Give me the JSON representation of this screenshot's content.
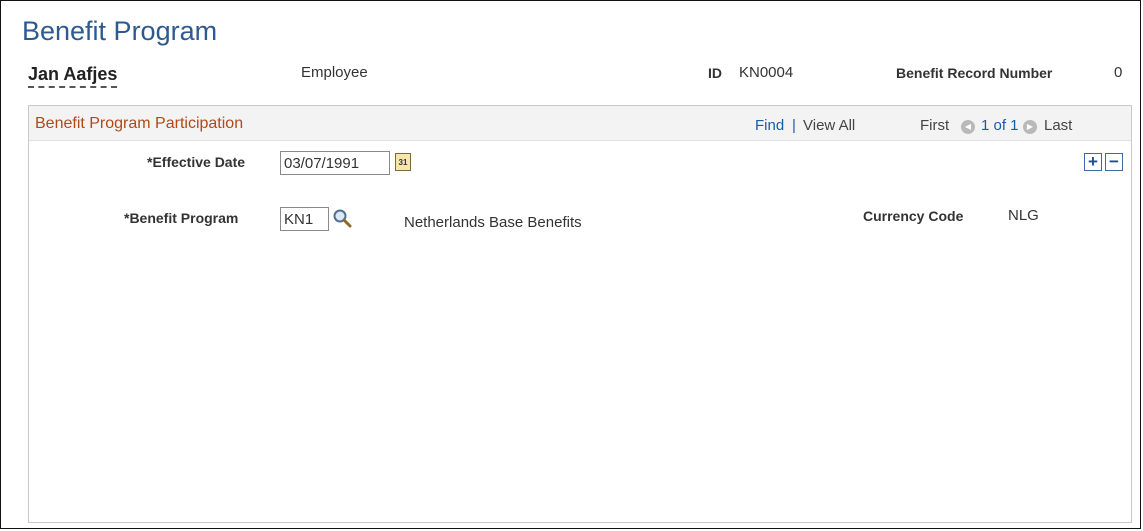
{
  "page": {
    "title": "Benefit Program"
  },
  "employee": {
    "name": "Jan Aafjes",
    "relation": "Employee",
    "id_label": "ID",
    "id_value": "KN0004",
    "benefit_record_label": "Benefit Record Number",
    "benefit_record_value": "0"
  },
  "grid": {
    "title": "Benefit Program Participation",
    "find_label": "Find",
    "separator": "|",
    "view_all_label": "View All",
    "first_label": "First",
    "page_info": "1 of 1",
    "last_label": "Last",
    "prev_glyph": "◀",
    "next_glyph": "▶"
  },
  "fields": {
    "effective_date": {
      "label": "*Effective Date",
      "value": "03/07/1991",
      "calendar_glyph": "31"
    },
    "benefit_program": {
      "label": "*Benefit Program",
      "value": "KN1",
      "description": "Netherlands Base Benefits"
    },
    "currency": {
      "label": "Currency Code",
      "value": "NLG"
    }
  },
  "actions": {
    "add_glyph": "+",
    "remove_glyph": "−"
  },
  "icons": {
    "calendar": "calendar-icon",
    "lookup": "search-icon",
    "prev": "previous-arrow-icon",
    "next": "next-arrow-icon",
    "add": "add-row-icon",
    "remove": "delete-row-icon"
  },
  "colors": {
    "title": "#2f5a8e",
    "section_title": "#b04a18",
    "link": "#1a5aa6"
  }
}
